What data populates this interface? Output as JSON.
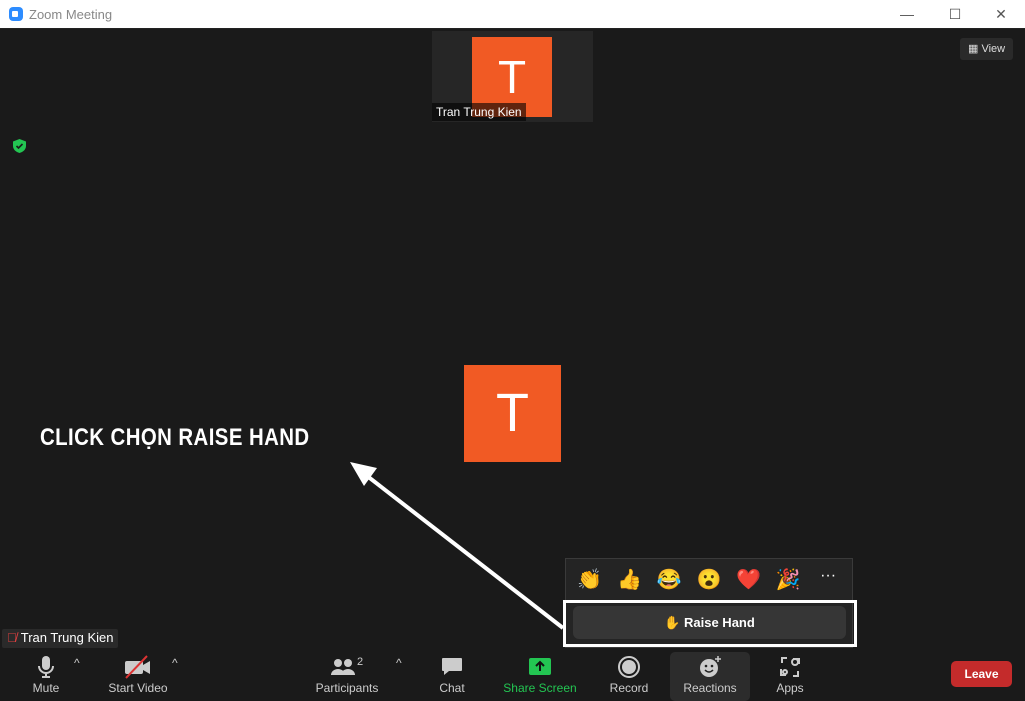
{
  "window": {
    "title": "Zoom Meeting",
    "minimize": "—",
    "maximize": "☐",
    "close": "✕"
  },
  "view_button": {
    "label": "View"
  },
  "thumbnail": {
    "initial": "T",
    "name": "Tran Trung Kien"
  },
  "main_video": {
    "initial": "T"
  },
  "caption": "CLICK CHỌN RAISE HAND",
  "reactions_popup": {
    "emojis": [
      "👏",
      "👍",
      "😂",
      "😮",
      "❤️",
      "🎉"
    ],
    "more": "···",
    "raise_hand": "Raise Hand",
    "raise_hand_icon": "✋"
  },
  "self_name": "Tran Trung Kien",
  "toolbar": {
    "mute": "Mute",
    "start_video": "Start Video",
    "participants": "Participants",
    "participants_count": "2",
    "chat": "Chat",
    "share_screen": "Share Screen",
    "record": "Record",
    "reactions": "Reactions",
    "apps": "Apps",
    "leave": "Leave"
  },
  "colors": {
    "avatar": "#f15a24",
    "share": "#23c552",
    "leave": "#c42b2b",
    "background": "#1a1a1a"
  }
}
